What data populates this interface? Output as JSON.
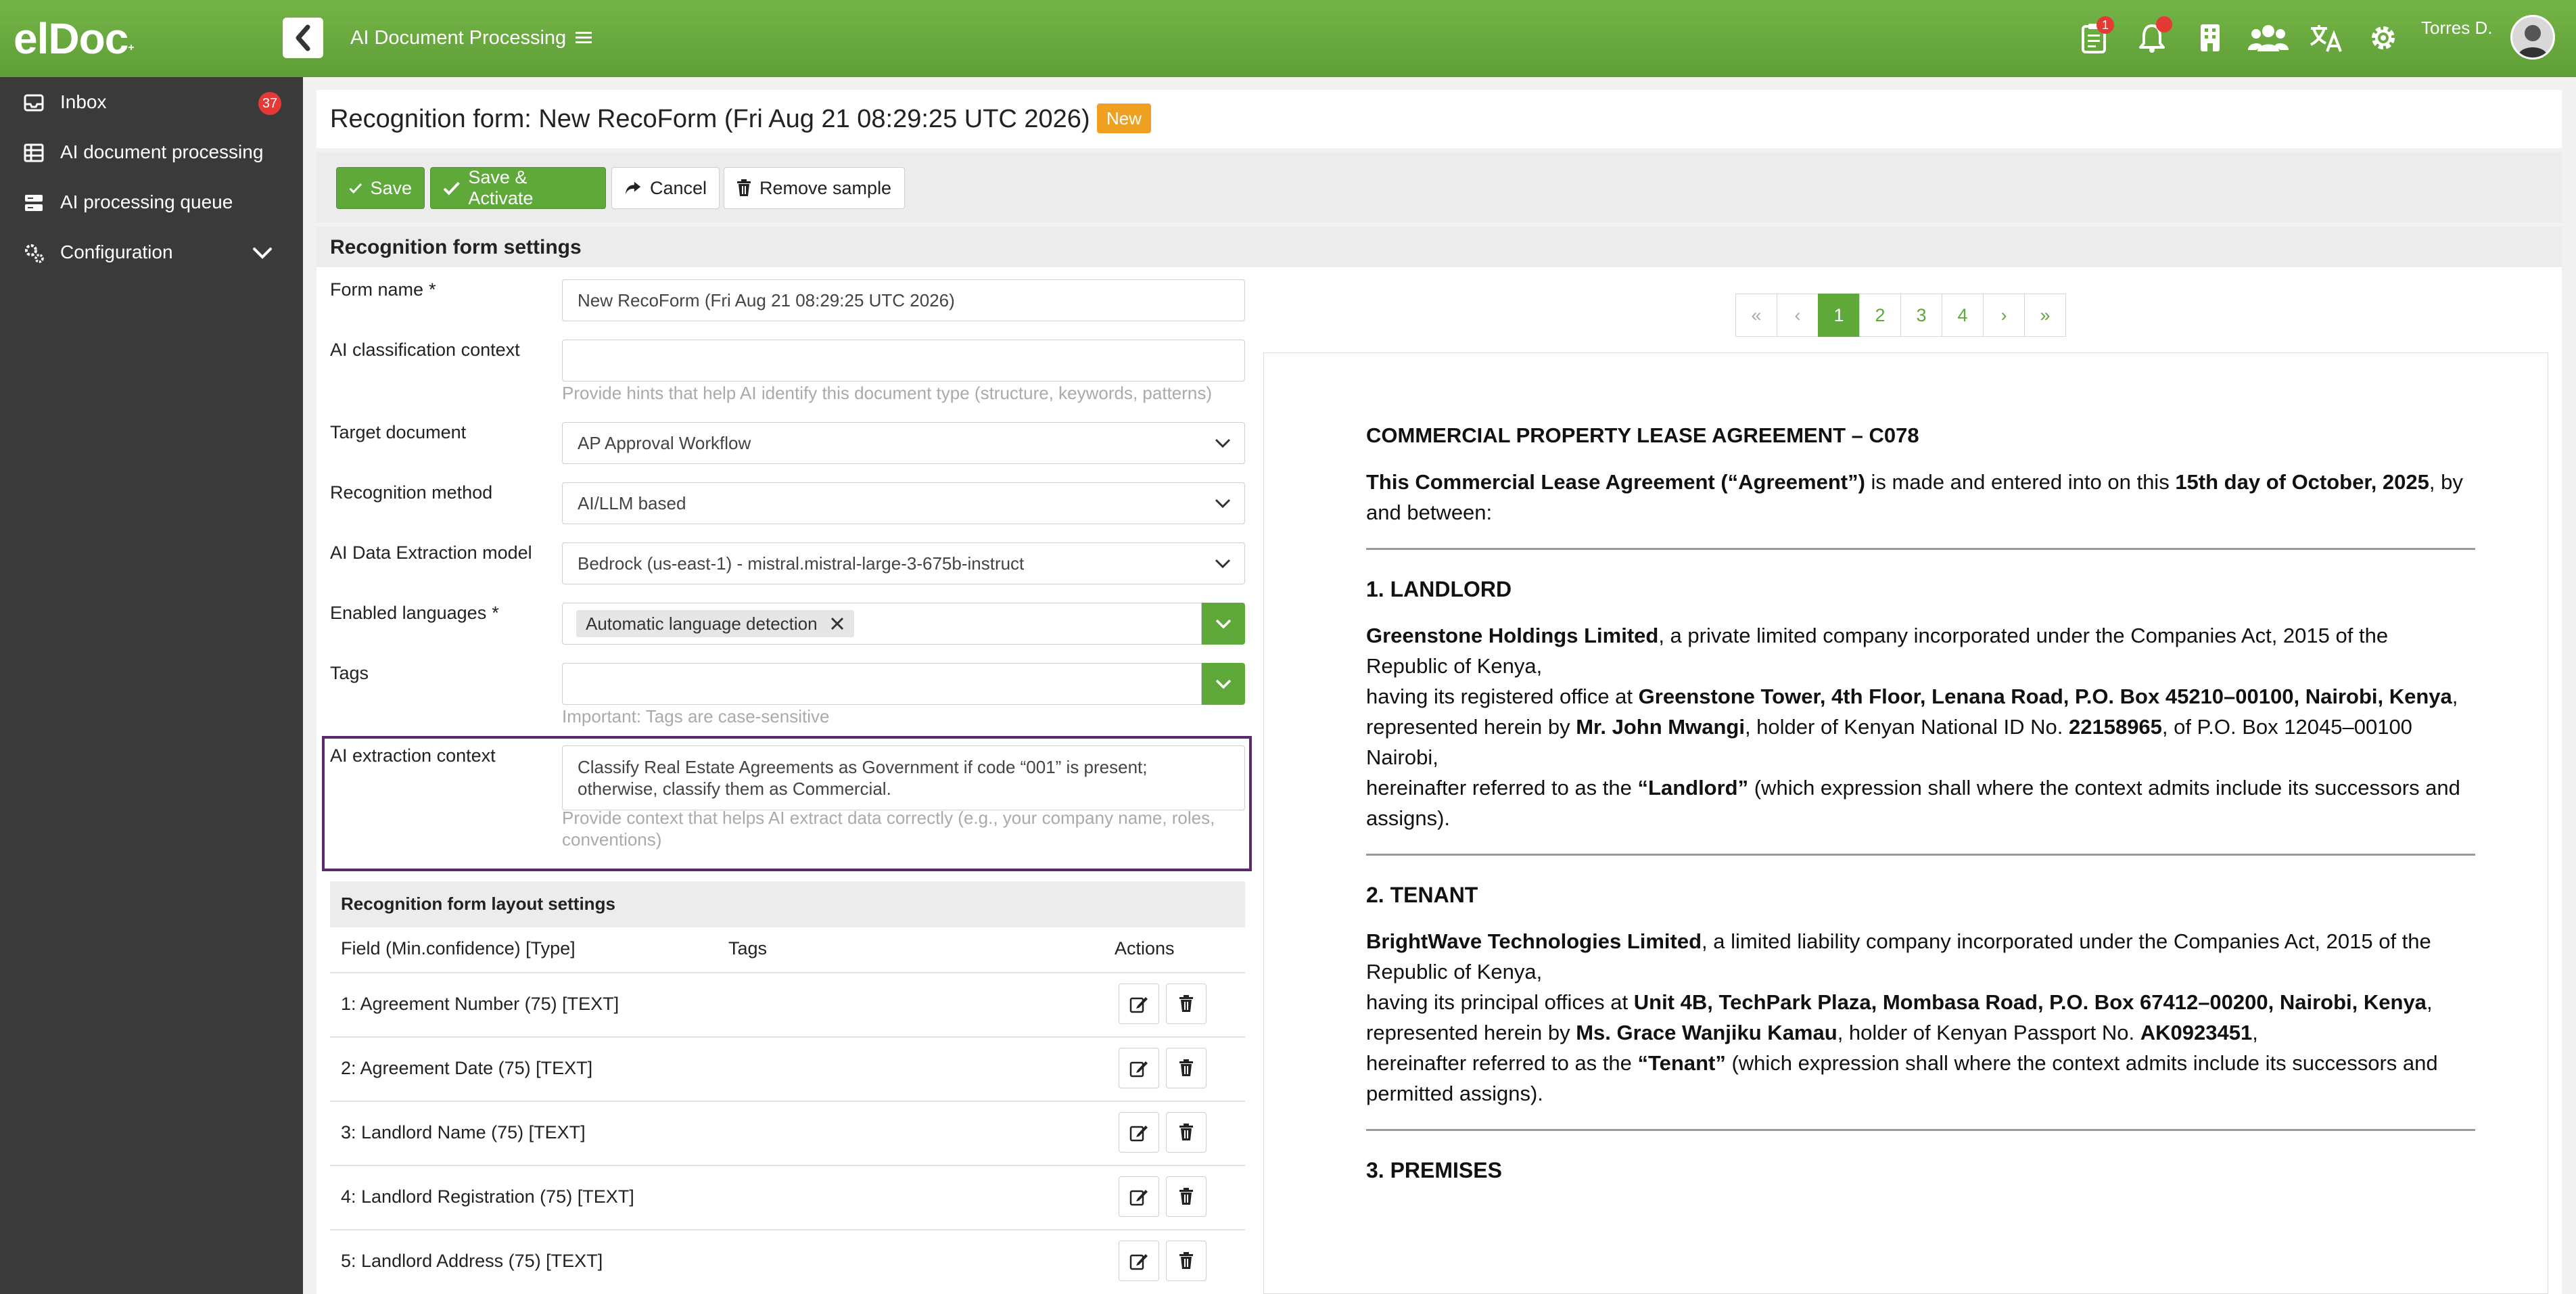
{
  "app": {
    "logo_text": "elDoc",
    "logo_mark": "+",
    "title": "AI Document Processing",
    "notification_count": "1",
    "user_name": "Torres D."
  },
  "sidebar": {
    "items": [
      {
        "label": "Inbox",
        "badge": "37",
        "icon": "inbox-icon"
      },
      {
        "label": "AI document processing",
        "icon": "table-icon"
      },
      {
        "label": "AI processing queue",
        "icon": "server-icon"
      },
      {
        "label": "Configuration",
        "icon": "gears-icon"
      }
    ]
  },
  "header": {
    "title": "Recognition form: New RecoForm (Fri Aug 21 08:29:25 UTC 2026)",
    "status_badge": "New"
  },
  "toolbar": {
    "save_label": "Save",
    "save_activate_label": "Save & Activate",
    "cancel_label": "Cancel",
    "remove_sample_label": "Remove sample"
  },
  "settings": {
    "section_title": "Recognition form settings",
    "form_name_label": "Form name",
    "form_name_value": "New RecoForm (Fri Aug 21 08:29:25 UTC 2026)",
    "ai_class_label": "AI classification context",
    "ai_class_value": "",
    "ai_class_hint": "Provide hints that help AI identify this document type (structure, keywords, patterns)",
    "target_doc_label": "Target document",
    "target_doc_value": "AP Approval Workflow",
    "method_label": "Recognition method",
    "method_value": "AI/LLM based",
    "model_label": "AI Data Extraction model",
    "model_value": "Bedrock (us-east-1) - mistral.mistral-large-3-675b-instruct",
    "languages_label": "Enabled languages",
    "languages_chip": "Automatic language detection",
    "tags_label": "Tags",
    "tags_value": "",
    "tags_hint": "Important: Tags are case-sensitive",
    "extraction_label": "AI extraction context",
    "extraction_value_line1": "Classify Real Estate Agreements as Government if code “001” is present;",
    "extraction_value_line2": "otherwise, classify them as Commercial.",
    "extraction_hint_line1": "Provide context that helps AI extract data correctly (e.g., your company name, roles,",
    "extraction_hint_line2": "conventions)",
    "required_mark": "*"
  },
  "layout": {
    "title": "Recognition form layout settings",
    "columns": [
      "Field (Min.confidence) [Type]",
      "Tags",
      "Actions"
    ],
    "rows": [
      "1: Agreement Number (75) [TEXT]",
      "2: Agreement Date (75) [TEXT]",
      "3: Landlord Name (75) [TEXT]",
      "4: Landlord Registration (75) [TEXT]",
      "5: Landlord Address (75) [TEXT]"
    ]
  },
  "pager": {
    "first": "«",
    "prev": "‹",
    "pages": [
      "1",
      "2",
      "3",
      "4"
    ],
    "current": "1",
    "next": "›",
    "last": "»"
  },
  "document": {
    "heading": "COMMERCIAL PROPERTY LEASE AGREEMENT – C078",
    "intro_b1": "This Commercial Lease Agreement (“Agreement”)",
    "intro_t1": " is made and entered into on this ",
    "intro_b2": "15th day of October, 2025",
    "intro_t2": ", by and between:",
    "s1_title": "1. LANDLORD",
    "s1_b1": "Greenstone Holdings Limited",
    "s1_t1": ", a private limited company incorporated under the Companies Act, 2015 of the Republic of Kenya,",
    "s1_t2": "having its registered office at ",
    "s1_b2": "Greenstone Tower, 4th Floor, Lenana Road, P.O. Box 45210–00100, Nairobi, Kenya",
    "s1_t3": ",",
    "s1_t4": "represented herein by ",
    "s1_b3": "Mr. John Mwangi",
    "s1_t5": ", holder of Kenyan National ID No. ",
    "s1_b4": "22158965",
    "s1_t6": ", of P.O. Box 12045–00100 Nairobi,",
    "s1_t7": "hereinafter referred to as the ",
    "s1_b5": "“Landlord”",
    "s1_t8": " (which expression shall where the context admits include its successors and assigns).",
    "s2_title": "2. TENANT",
    "s2_b1": "BrightWave Technologies Limited",
    "s2_t1": ", a limited liability company incorporated under the Companies Act, 2015 of the Republic of Kenya,",
    "s2_t2": "having its principal offices at ",
    "s2_b2": "Unit 4B, TechPark Plaza, Mombasa Road, P.O. Box 67412–00200, Nairobi, Kenya",
    "s2_t3": ",",
    "s2_t4": "represented herein by ",
    "s2_b3": "Ms. Grace Wanjiku Kamau",
    "s2_t5": ", holder of Kenyan Passport No. ",
    "s2_b4": "AK0923451",
    "s2_t6": ",",
    "s2_t7": "hereinafter referred to as the ",
    "s2_b5": "“Tenant”",
    "s2_t8": " (which expression shall where the context admits include its successors and permitted assigns).",
    "s3_title": "3. PREMISES"
  },
  "colors": {
    "brand_green": "#5fa83a",
    "sidebar_bg": "#3a3a3a",
    "badge_red": "#e53935",
    "new_badge": "#f0a020",
    "highlight_border": "#5a2a6e"
  }
}
